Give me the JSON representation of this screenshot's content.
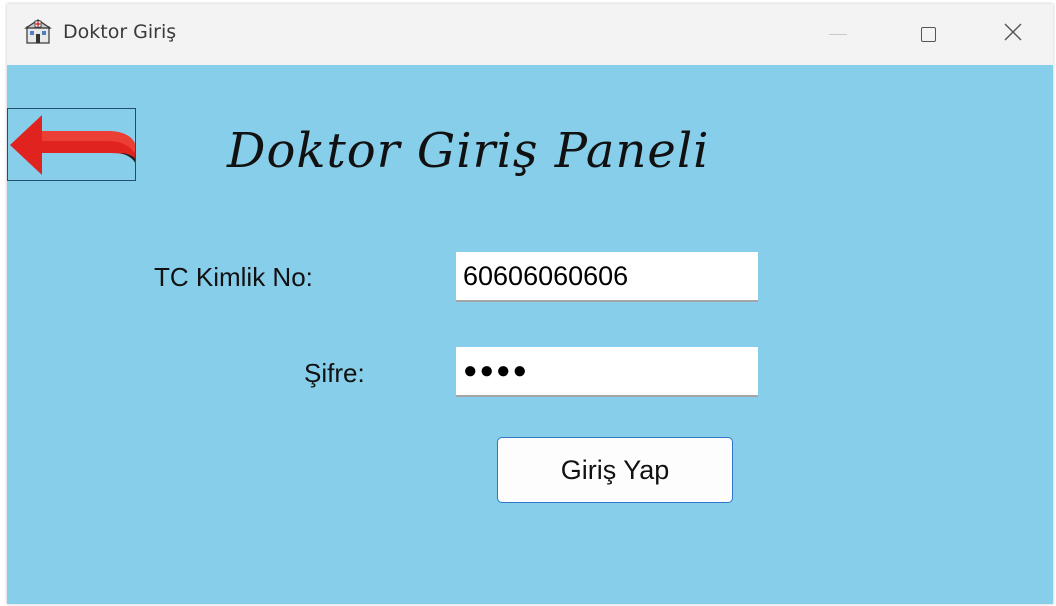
{
  "window": {
    "title": "Doktor Giriş",
    "icon": "hospital-icon"
  },
  "controls": {
    "minimize_icon": "minimize-icon",
    "maximize_icon": "maximize-icon",
    "close_icon": "close-icon"
  },
  "form": {
    "heading": "Doktor Giriş Paneli",
    "tc_label": "TC Kimlik No:",
    "tc_value": "60606060606",
    "password_label": "Şifre:",
    "password_value": "●●●●",
    "submit_label": "Giriş Yap",
    "back_icon": "back-arrow-icon"
  },
  "colors": {
    "background": "#87ceeb",
    "arrow": "#e02020",
    "button_border": "#2e78c7"
  }
}
